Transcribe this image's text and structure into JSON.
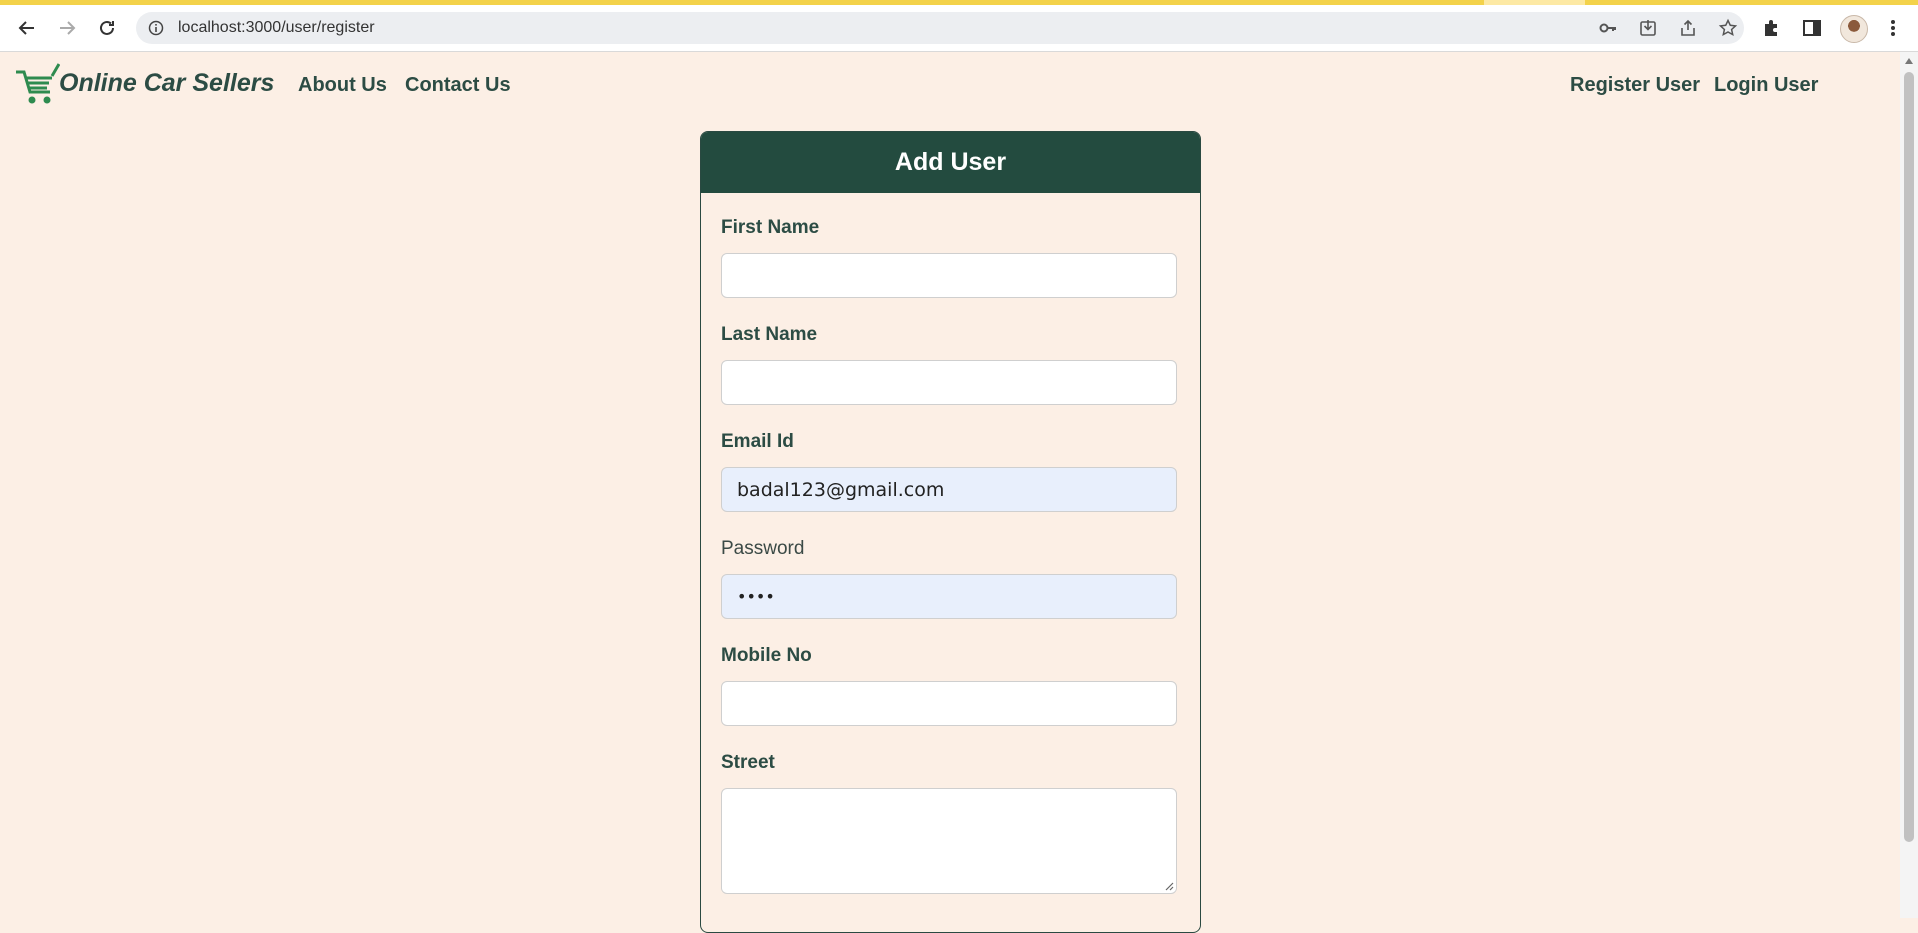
{
  "browser": {
    "url": "localhost:3000/user/register"
  },
  "navbar": {
    "brand": "Online Car Sellers",
    "links_left": [
      "About Us",
      "Contact Us"
    ],
    "links_right": [
      "Register User",
      "Login User"
    ]
  },
  "form": {
    "title": "Add User",
    "fields": [
      {
        "label": "First Name",
        "value": ""
      },
      {
        "label": "Last Name",
        "value": ""
      },
      {
        "label": "Email Id",
        "value": "badal123@gmail.com"
      },
      {
        "label": "Password",
        "value": "••••"
      },
      {
        "label": "Mobile No",
        "value": ""
      },
      {
        "label": "Street",
        "value": ""
      }
    ]
  },
  "colors": {
    "page_bg": "#fcefe5",
    "brand_green": "#234b3f",
    "autofill_bg": "#e8effc"
  },
  "icons": [
    "back-arrow-icon",
    "forward-arrow-icon",
    "reload-icon",
    "info-icon",
    "key-icon",
    "install-icon",
    "share-icon",
    "star-icon",
    "puzzle-icon",
    "sidebar-icon",
    "avatar",
    "kebab-menu-icon",
    "cart-logo-icon"
  ]
}
